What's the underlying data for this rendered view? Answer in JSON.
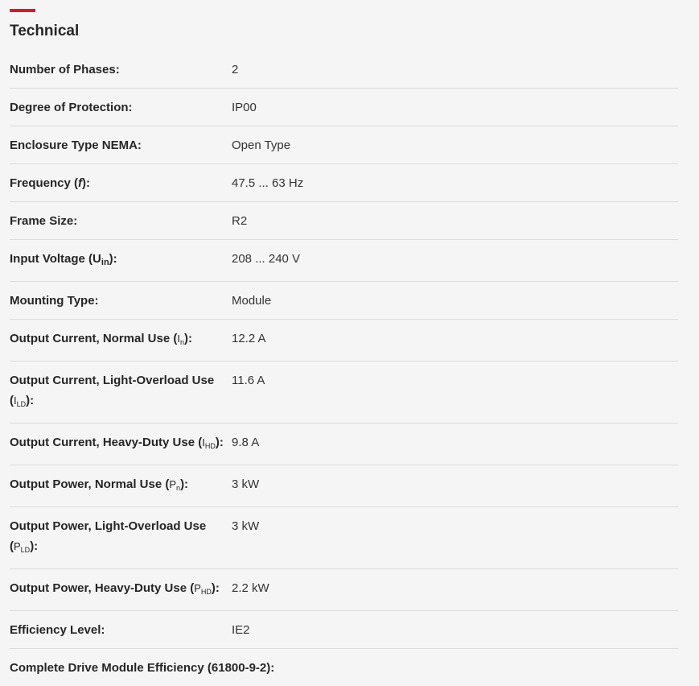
{
  "section": {
    "title": "Technical",
    "accent_color": "#e8131f"
  },
  "specs": [
    {
      "label": "Number of Phases:",
      "value": "2"
    },
    {
      "label": "Degree of Protection:",
      "value": "IP00"
    },
    {
      "label": "Enclosure Type NEMA:",
      "value": "Open Type"
    },
    {
      "label_prefix": "Frequency (",
      "label_symbol": "f",
      "label_suffix": "):",
      "value": "47.5 ... 63 Hz"
    },
    {
      "label": "Frame Size:",
      "value": "R2"
    },
    {
      "label_prefix": "Input Voltage (U",
      "label_sub": "in",
      "label_suffix": "):",
      "value": "208 ... 240 V"
    },
    {
      "label": "Mounting Type:",
      "value": "Module"
    },
    {
      "label_prefix": "Output Current, Normal Use (",
      "label_symbol": "I",
      "label_sub": "n",
      "label_suffix": "):",
      "value": "12.2 A"
    },
    {
      "label_prefix": "Output Current, Light-Overload Use (",
      "label_symbol": "I",
      "label_sub": "LD",
      "label_suffix": "):",
      "value": "11.6 A"
    },
    {
      "label_prefix": "Output Current, Heavy-Duty Use (",
      "label_symbol": "I",
      "label_sub": "HD",
      "label_suffix": "):",
      "value": "9.8 A"
    },
    {
      "label_prefix": "Output Power, Normal Use (",
      "label_symbol": "P",
      "label_sub": "n",
      "label_suffix": "):",
      "value": "3 kW"
    },
    {
      "label_prefix": "Output Power, Light-Overload Use (",
      "label_symbol": "P",
      "label_sub": "LD",
      "label_suffix": "):",
      "value": "3 kW"
    },
    {
      "label_prefix": "Output Power, Heavy-Duty Use (",
      "label_symbol": "P",
      "label_sub": "HD",
      "label_suffix": "):",
      "value": "2.2 kW"
    },
    {
      "label": "Efficiency Level:",
      "value": "IE2"
    },
    {
      "label": "Complete Drive Module Efficiency (61800-9-2):",
      "value": ""
    }
  ]
}
